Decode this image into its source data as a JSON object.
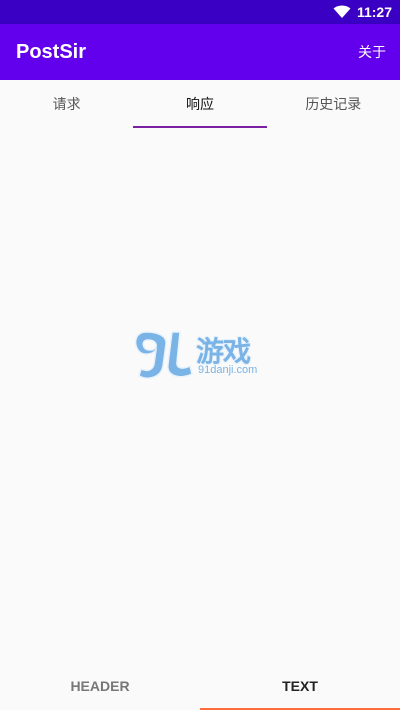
{
  "status_bar": {
    "time": "11:27",
    "icons": [
      "wifi-icon"
    ]
  },
  "app_bar": {
    "title": "PostSir",
    "about_label": "关于"
  },
  "top_tabs": {
    "items": [
      {
        "label": "请求",
        "active": false
      },
      {
        "label": "响应",
        "active": true
      },
      {
        "label": "历史记录",
        "active": false
      }
    ],
    "indicator_color": "#7b1fa2"
  },
  "watermark": {
    "brand_text": "游戏",
    "brand_mark": "9L",
    "url": "91danji.com"
  },
  "bottom_tabs": {
    "items": [
      {
        "label": "HEADER",
        "active": false
      },
      {
        "label": "TEXT",
        "active": true
      }
    ],
    "indicator_color": "#ff6d3a"
  },
  "colors": {
    "status_bar": "#3a00c4",
    "app_bar": "#6200ee",
    "background": "#fafafa"
  }
}
